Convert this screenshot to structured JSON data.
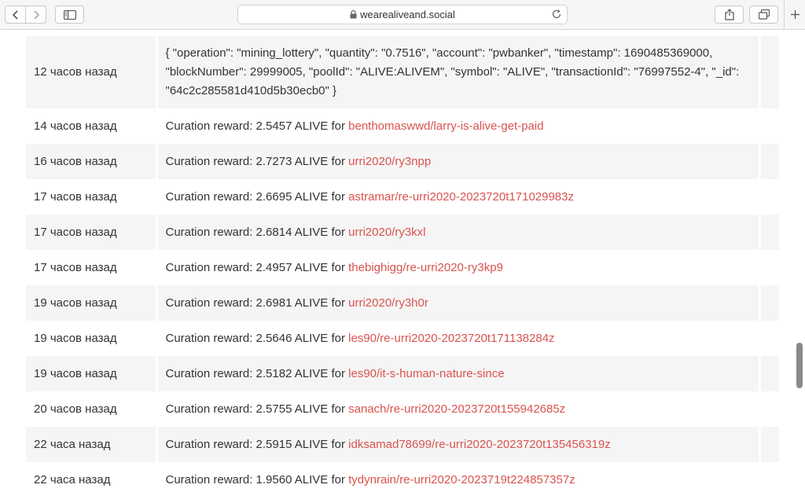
{
  "browser": {
    "url": "wearealiveand.social",
    "icons": {
      "back": "chevron-left-icon",
      "forward": "chevron-right-icon",
      "sidebar": "sidebar-icon",
      "lock": "lock-icon",
      "reload": "reload-icon",
      "share": "share-icon",
      "tabs": "tabs-icon",
      "new_tab": "plus-icon"
    }
  },
  "colors": {
    "link": "#d9534f",
    "text": "#333333",
    "stripe": "#f5f5f5"
  },
  "transactions": [
    {
      "time": "12 часов назад",
      "line1": "{ \"operation\": \"mining_lottery\", \"quantity\": \"0.7516\", \"account\": \"pwbanker\", \"timestamp\": 1690485369000,",
      "line2": "\"blockNumber\": 29999005, \"poolId\": \"ALIVE:ALIVEM\", \"symbol\": \"ALIVE\", \"transactionId\": \"76997552-4\", \"_id\":",
      "line3": "\"64c2c285581d410d5b30ecb0\" }"
    },
    {
      "time": "14 часов назад",
      "text": "Curation reward: 2.5457 ALIVE for ",
      "link": "benthomaswwd/larry-is-alive-get-paid"
    },
    {
      "time": "16 часов назад",
      "text": "Curation reward: 2.7273 ALIVE for ",
      "link": "urri2020/ry3npp"
    },
    {
      "time": "17 часов назад",
      "text": "Curation reward: 2.6695 ALIVE for ",
      "link": "astramar/re-urri2020-2023720t171029983z"
    },
    {
      "time": "17 часов назад",
      "text": "Curation reward: 2.6814 ALIVE for ",
      "link": "urri2020/ry3kxl"
    },
    {
      "time": "17 часов назад",
      "text": "Curation reward: 2.4957 ALIVE for ",
      "link": "thebighigg/re-urri2020-ry3kp9"
    },
    {
      "time": "19 часов назад",
      "text": "Curation reward: 2.6981 ALIVE for ",
      "link": "urri2020/ry3h0r"
    },
    {
      "time": "19 часов назад",
      "text": "Curation reward: 2.5646 ALIVE for ",
      "link": "les90/re-urri2020-2023720t171138284z"
    },
    {
      "time": "19 часов назад",
      "text": "Curation reward: 2.5182 ALIVE for ",
      "link": "les90/it-s-human-nature-since"
    },
    {
      "time": "20 часов назад",
      "text": "Curation reward: 2.5755 ALIVE for ",
      "link": "sanach/re-urri2020-2023720t155942685z"
    },
    {
      "time": "22 часа назад",
      "text": "Curation reward: 2.5915 ALIVE for ",
      "link": "idksamad78699/re-urri2020-2023720t135456319z"
    },
    {
      "time": "22 часа назад",
      "text": "Curation reward: 1.9560 ALIVE for ",
      "link": "tydynrain/re-urri2020-2023719t224857357z"
    }
  ]
}
